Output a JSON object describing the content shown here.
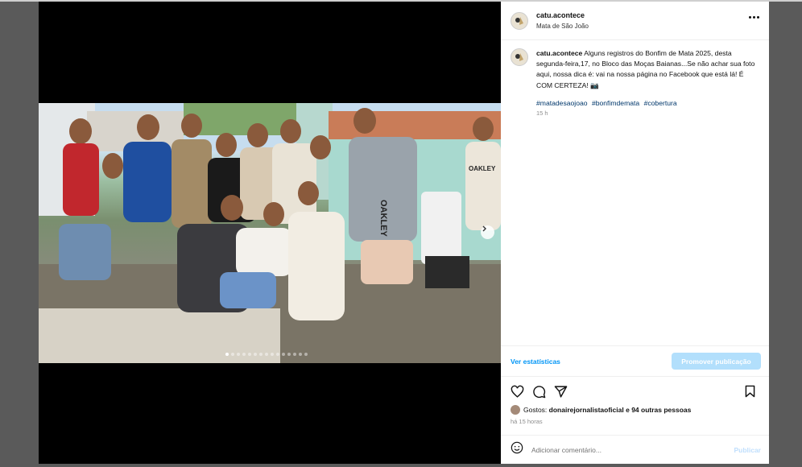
{
  "post": {
    "username": "catu.acontece",
    "location": "Mata de São João",
    "caption_username": "catu.acontece",
    "caption": "Alguns registros do Bonfim de Mata 2025, desta segunda-feira,17, no Bloco das Moças Baianas...Se não achar sua foto aqui, nossa dica é: vai na nossa página no Facebook que está lá! É COM CERTEZA! 📷",
    "hashtags": [
      "#matadesaojoao",
      "#bonfimdemata",
      "#cobertura"
    ],
    "timestamp": "15 h",
    "photo_shirt_text_1": "OAKLEY",
    "photo_shirt_text_2": "OAKLEY"
  },
  "insights": {
    "view_insights_label": "Ver estatísticas",
    "promote_label": "Promover publicação"
  },
  "likes": {
    "prefix": "Gostos:",
    "liker": "donairejornalistaoficial",
    "suffix": "e 94 outras pessoas",
    "time": "há 15 horas"
  },
  "comment": {
    "placeholder": "Adicionar comentário...",
    "publish_label": "Publicar"
  },
  "carousel": {
    "total_dots": 15,
    "active_dot": 1
  },
  "icons": {
    "like": "heart-icon",
    "comment": "comment-icon",
    "share": "send-icon",
    "save": "bookmark-icon",
    "more": "more-options-icon",
    "next": "chevron-right-icon",
    "emoji": "emoji-icon"
  },
  "colors": {
    "link_blue": "#0095f6",
    "promote_bg": "#b2dffc",
    "hashtag": "#00376b"
  }
}
